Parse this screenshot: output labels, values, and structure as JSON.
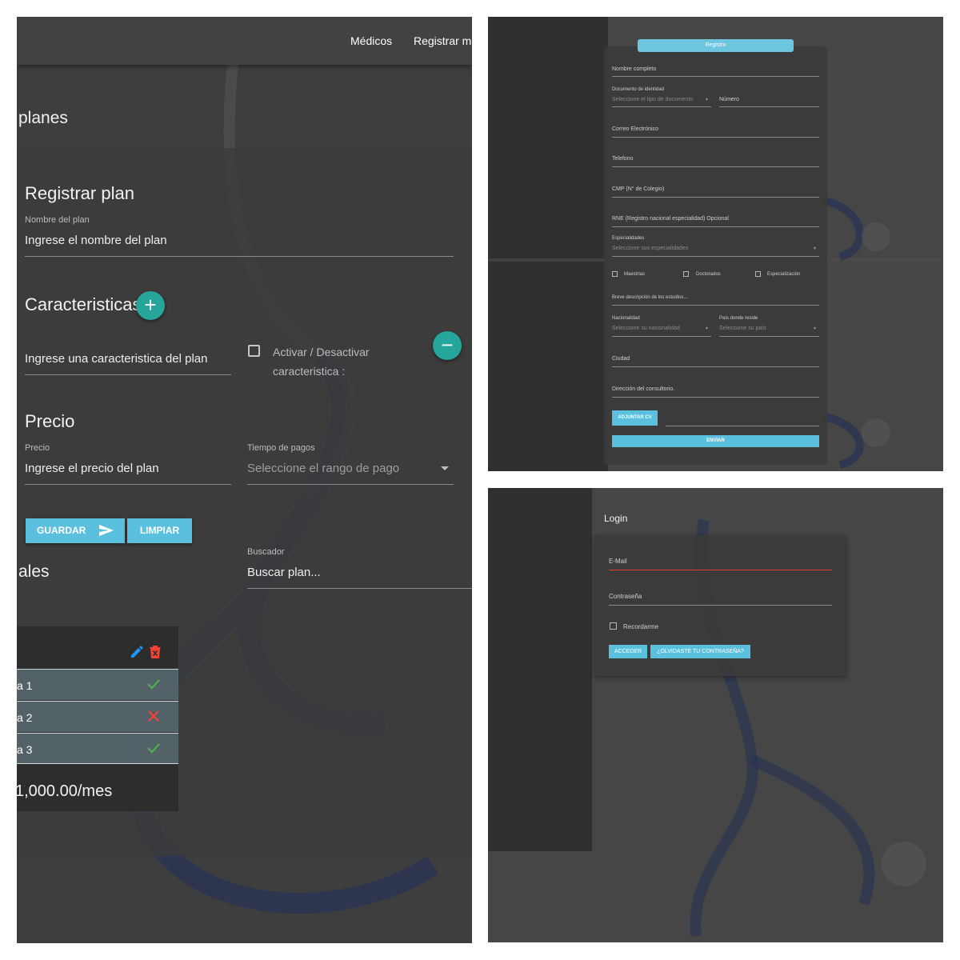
{
  "colors": {
    "nav_bg": "#424242",
    "accent_button": "#5bc0de",
    "fab_teal": "#26a69a",
    "success_check": "#4caf50",
    "error_cross": "#f44336",
    "edit_icon": "#2196f3",
    "delete_icon": "#f44336",
    "invalid_underline": "#e53935",
    "header_tab": "#6cc6e0"
  },
  "plans_panel": {
    "nav": [
      "Médicos",
      "Registrar m"
    ],
    "page_title": "planes",
    "form_title": "Registrar plan",
    "plan_name_label": "Nombre del plan",
    "plan_name_value": "Ingrese el nombre del plan",
    "features_title": "Caracteristicas",
    "add_feature_glyph": "+",
    "feature_value": "Ingrese una caracteristica del plan",
    "feature_toggle_label": "Activar / Desactivar caracteristica :",
    "remove_feature_glyph": "−",
    "price_title": "Precio",
    "price_label": "Precio",
    "price_value": "Ingrese el precio del plan",
    "payment_label": "Tiempo de pagos",
    "payment_placeholder": "Seleccione el rango de pago",
    "save_button": "GUARDAR",
    "clear_button": "LIMPIAR",
    "search_label": "Buscador",
    "search_value": "Buscar plan...",
    "list_title": "ales",
    "plan_card": {
      "rows": [
        {
          "text": "a 1",
          "status": "check-icon"
        },
        {
          "text": "a 2",
          "status": "cross-icon"
        },
        {
          "text": "a 3",
          "status": "check-icon"
        }
      ],
      "price": "1,000.00/mes"
    }
  },
  "register_panel": {
    "header": "Registro",
    "full_name": "Nombre completo",
    "doc_label": "Documento de identidad",
    "doc_type_placeholder": "Seleccione el tipo de documento",
    "doc_number": "Número",
    "email": "Correo Electrónico",
    "phone": "Telefono",
    "cmp": "CMP (N° de Colegio)",
    "rne": "RNE (Registro nacional especialidad) Opcional",
    "specialties_label": "Especialidades",
    "specialties_placeholder": "Seleccione sus especialidades",
    "studies": [
      "Maestrias",
      "Doctorados",
      "Especialización"
    ],
    "studies_description": "Breve descripción de los estudios...",
    "nationality_label": "Nacionalidad",
    "nationality_placeholder": "Seleccione su nacionalidad",
    "country_label": "País donde reside",
    "country_placeholder": "Seleccione su país",
    "city": "Ciudad",
    "office_address": "Dirección del consultorio.",
    "attach_cv": "ADJUNTAR CV",
    "submit": "ENVIAR"
  },
  "login_panel": {
    "title": "Login",
    "email_label": "E-Mail",
    "password_label": "Contraseña",
    "remember": "Recordarme",
    "login_button": "ACCEDER",
    "forgot_button": "¿OLVIDASTE TU CONTRASEÑA?"
  }
}
